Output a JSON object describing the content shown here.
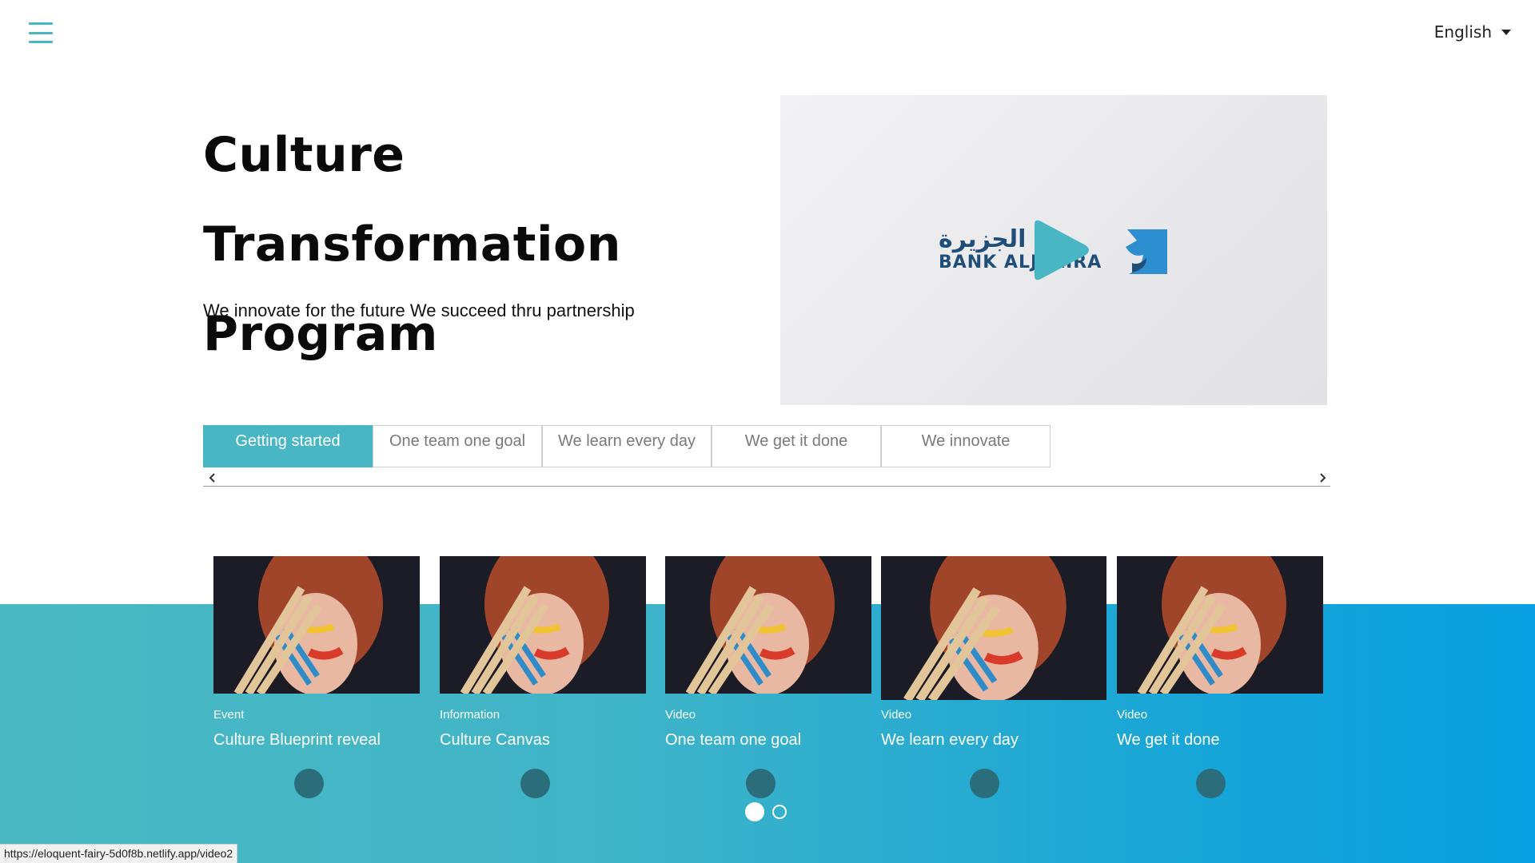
{
  "header": {
    "menu_icon": "hamburger-icon",
    "language": {
      "selected": "English",
      "icon": "caret-down-icon"
    }
  },
  "hero": {
    "title": "Culture Transformation Program",
    "subtitle": "We innovate for the future We succeed thru partnership",
    "video": {
      "logo_text_en": "BANK ALJAZIRA",
      "logo_text_ar": "بنك الجزيرة",
      "play_icon": "play-icon",
      "play_color": "#49b6c4"
    }
  },
  "tabs": {
    "items": [
      {
        "label": "Getting started",
        "active": true
      },
      {
        "label": "One team one goal",
        "active": false
      },
      {
        "label": "We learn every day",
        "active": false
      },
      {
        "label": "We get it done",
        "active": false
      },
      {
        "label": "We innovate",
        "active": false
      }
    ],
    "prev_icon": "chevron-left-icon",
    "next_icon": "chevron-right-icon",
    "accent": "#49b6c4"
  },
  "cards": [
    {
      "type": "Event",
      "title": "Culture Blueprint reveal"
    },
    {
      "type": "Information",
      "title": "Culture Canvas"
    },
    {
      "type": "Video",
      "title": "One team one goal"
    },
    {
      "type": "Video",
      "title": "We learn every day"
    },
    {
      "type": "Video",
      "title": "We get it done"
    }
  ],
  "pager": {
    "pages": 2,
    "current": 1
  },
  "status_url": "https://eloquent-fairy-5d0f8b.netlify.app/video2",
  "colors": {
    "band_start": "#4ab9c1",
    "band_end": "#07a0e0",
    "card_dot": "#2b6d7a"
  }
}
